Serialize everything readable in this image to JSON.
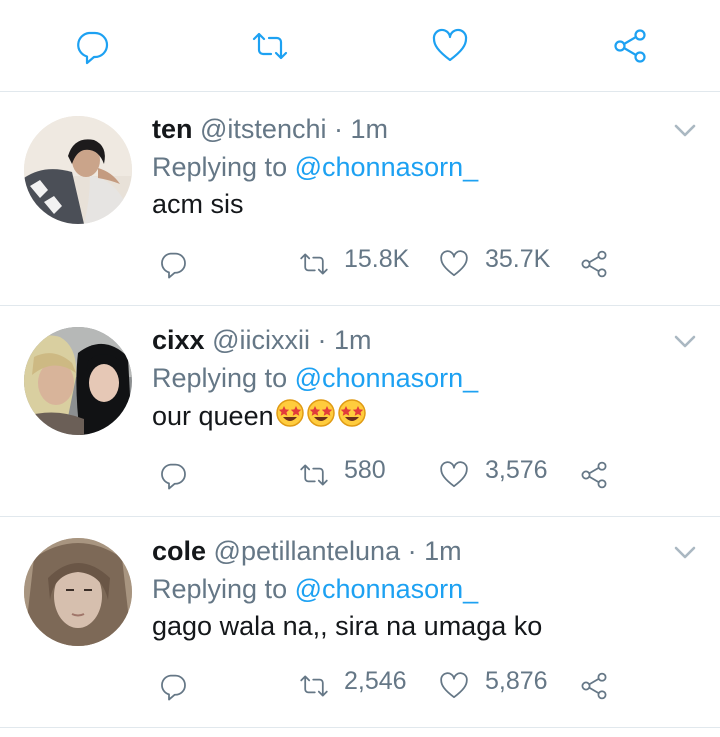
{
  "action_bar": {
    "icons": [
      "reply-icon",
      "retweet-icon",
      "like-icon",
      "share-icon"
    ]
  },
  "colors": {
    "accent": "#1da1f2",
    "muted": "#657786",
    "text": "#14171a",
    "divider": "#e1e8ed"
  },
  "tweets": [
    {
      "name": "ten",
      "handle": "@itstenchi",
      "separator": "·",
      "time": "1m",
      "replying_prefix": "Replying to",
      "replying_to": "@chonnasorn_",
      "text": "acm sis",
      "retweets": "15.8K",
      "likes": "35.7K"
    },
    {
      "name": "cixx",
      "handle": "@iicixxii",
      "separator": "·",
      "time": "1m",
      "replying_prefix": "Replying to",
      "replying_to": "@chonnasorn_",
      "text": "our queen",
      "emoji": "star-struck",
      "emoji_count": 3,
      "retweets": "580",
      "likes": "3,576"
    },
    {
      "name": "cole",
      "handle": "@petillanteluna",
      "separator": "·",
      "time": "1m",
      "replying_prefix": "Replying to",
      "replying_to": "@chonnasorn_",
      "text": "gago wala na,, sira na umaga ko",
      "retweets": "2,546",
      "likes": "5,876"
    }
  ]
}
